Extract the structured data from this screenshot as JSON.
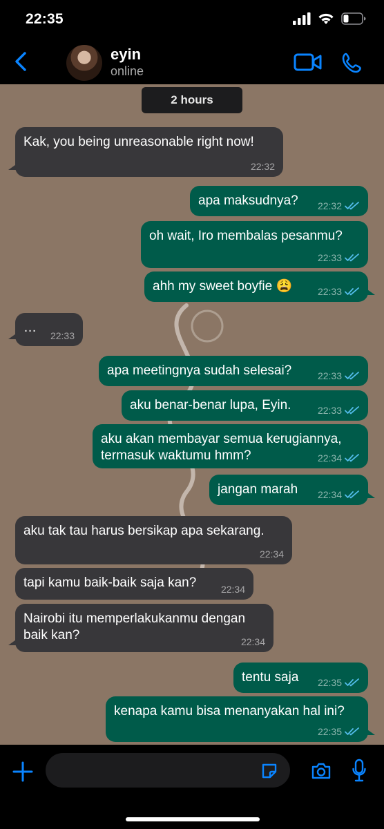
{
  "status": {
    "time": "22:35"
  },
  "header": {
    "name": "eyin",
    "status": "online"
  },
  "chat": {
    "date_chip": "2 hours"
  },
  "messages": [
    {
      "dir": "in",
      "text": "Kak, you being unreasonable right now!",
      "time": "22:32"
    },
    {
      "dir": "out",
      "text": "apa maksudnya?",
      "time": "22:32",
      "read": true
    },
    {
      "dir": "out",
      "text": "oh wait, Iro membalas pesanmu?",
      "time": "22:33",
      "read": true
    },
    {
      "dir": "out",
      "text": "ahh my sweet boyfie 😩",
      "time": "22:33",
      "read": true
    },
    {
      "dir": "in",
      "text": "…",
      "time": "22:33"
    },
    {
      "dir": "out",
      "text": "apa meetingnya sudah selesai?",
      "time": "22:33",
      "read": true
    },
    {
      "dir": "out",
      "text": "aku benar-benar lupa, Eyin.",
      "time": "22:33",
      "read": true
    },
    {
      "dir": "out",
      "text": "aku akan membayar semua kerugiannya,\ntermasuk waktumu hmm?",
      "time": "22:34",
      "read": true
    },
    {
      "dir": "out",
      "text": "jangan marah",
      "time": "22:34",
      "read": true
    },
    {
      "dir": "in",
      "text": "aku tak tau harus bersikap apa sekarang.",
      "time": "22:34"
    },
    {
      "dir": "in",
      "text": "tapi kamu baik-baik saja kan?",
      "time": "22:34"
    },
    {
      "dir": "in",
      "text": "Nairobi itu memperlakukanmu dengan\nbaik kan?",
      "time": "22:34"
    },
    {
      "dir": "out",
      "text": "tentu saja",
      "time": "22:35",
      "read": true
    },
    {
      "dir": "out",
      "text": "kenapa kamu bisa menanyakan hal ini?",
      "time": "22:35",
      "read": true
    }
  ],
  "icons": {
    "back": "chevron-left-icon",
    "video": "video-camera-icon",
    "call": "phone-icon",
    "plus": "plus-icon",
    "sticker": "sticker-icon",
    "camera": "camera-icon",
    "mic": "microphone-icon"
  },
  "colors": {
    "accent": "#0a84ff",
    "incoming": "#38373a",
    "outgoing": "#005b4a",
    "wallpaper": "#8b7665",
    "read_ticks": "#53bdeb"
  }
}
